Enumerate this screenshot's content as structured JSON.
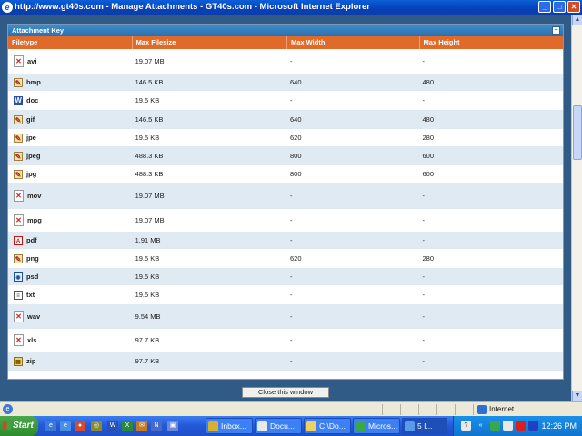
{
  "window": {
    "title": "http://www.gt40s.com - Manage Attachments - GT40s.com - Microsoft Internet Explorer",
    "min": "_",
    "max": "□",
    "close": "✕"
  },
  "panel": {
    "title": "Attachment Key",
    "collapse_icon": "−",
    "headers": [
      "Filetype",
      "Max Filesize",
      "Max Width",
      "Max Height"
    ],
    "rows": [
      {
        "type": "avi",
        "icon": "broken-image-icon",
        "size": "19.07 MB",
        "width": "-",
        "height": "-"
      },
      {
        "type": "bmp",
        "icon": "paint-icon",
        "size": "146.5 KB",
        "width": "640",
        "height": "480"
      },
      {
        "type": "doc",
        "icon": "word-doc-icon",
        "size": "19.5 KB",
        "width": "-",
        "height": "-"
      },
      {
        "type": "gif",
        "icon": "paint-icon",
        "size": "146.5 KB",
        "width": "640",
        "height": "480"
      },
      {
        "type": "jpe",
        "icon": "paint-icon",
        "size": "19.5 KB",
        "width": "620",
        "height": "280"
      },
      {
        "type": "jpeg",
        "icon": "paint-icon",
        "size": "488.3 KB",
        "width": "800",
        "height": "600"
      },
      {
        "type": "jpg",
        "icon": "paint-icon",
        "size": "488.3 KB",
        "width": "800",
        "height": "600"
      },
      {
        "type": "mov",
        "icon": "broken-image-icon",
        "size": "19.07 MB",
        "width": "-",
        "height": "-"
      },
      {
        "type": "mpg",
        "icon": "broken-image-icon",
        "size": "19.07 MB",
        "width": "-",
        "height": "-"
      },
      {
        "type": "pdf",
        "icon": "pdf-icon",
        "size": "1.91 MB",
        "width": "-",
        "height": "-"
      },
      {
        "type": "png",
        "icon": "paint-icon",
        "size": "19.5 KB",
        "width": "620",
        "height": "280"
      },
      {
        "type": "psd",
        "icon": "psd-icon",
        "size": "19.5 KB",
        "width": "-",
        "height": "-"
      },
      {
        "type": "txt",
        "icon": "txt-icon",
        "size": "19.5 KB",
        "width": "-",
        "height": "-"
      },
      {
        "type": "wav",
        "icon": "broken-image-icon",
        "size": "9.54 MB",
        "width": "-",
        "height": "-"
      },
      {
        "type": "xls",
        "icon": "broken-image-icon",
        "size": "97.7 KB",
        "width": "-",
        "height": "-"
      },
      {
        "type": "zip",
        "icon": "zip-icon",
        "size": "97.7 KB",
        "width": "-",
        "height": "-"
      }
    ],
    "close_button": "Close this window"
  },
  "statusbar": {
    "zone": "Internet"
  },
  "taskbar": {
    "start": "Start",
    "tasks": [
      "Inbox...",
      "Docu...",
      "C:\\Do...",
      "Micros...",
      "5 I..."
    ],
    "clock": "12:26 PM"
  },
  "colors": {
    "header_orange": "#e06a2a",
    "panel_blue": "#2a6fb0",
    "alt_row": "#dfeaf3"
  }
}
